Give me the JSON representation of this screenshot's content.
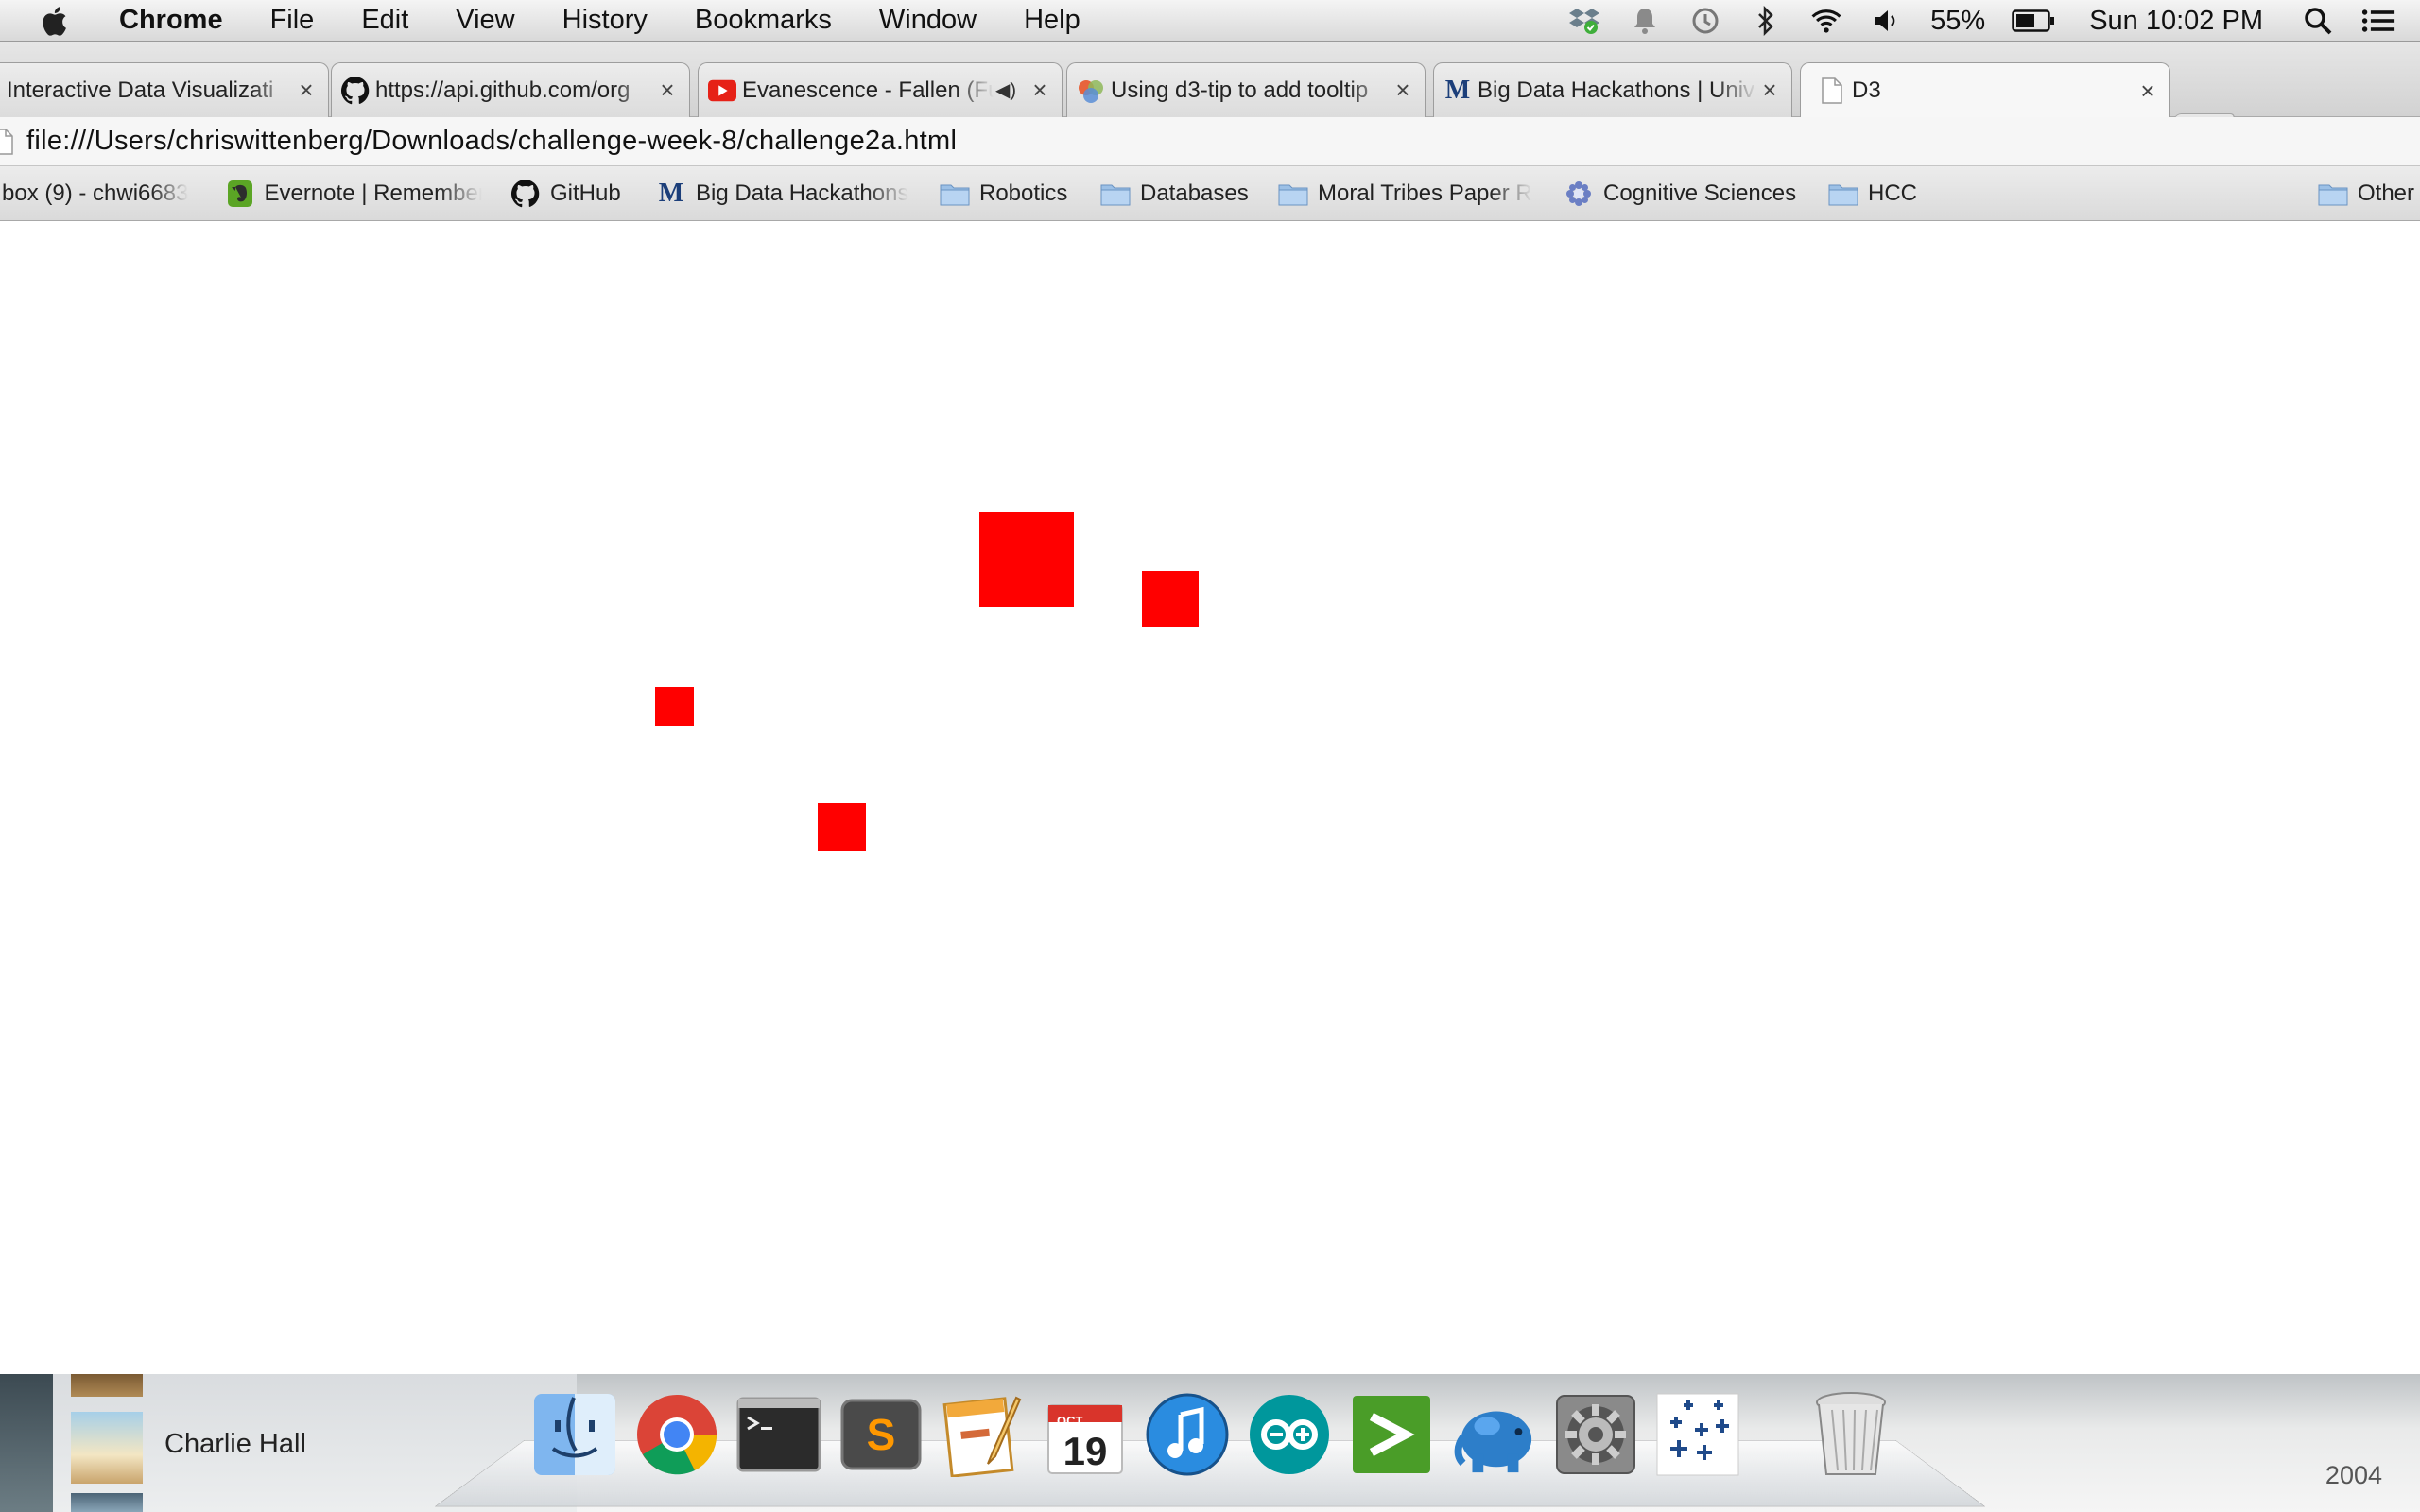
{
  "menubar": {
    "app_name": "Chrome",
    "menus": [
      "File",
      "Edit",
      "View",
      "History",
      "Bookmarks",
      "Window",
      "Help"
    ],
    "battery": "55%",
    "clock": "Sun 10:02 PM",
    "status_icons": [
      "dropbox-icon",
      "notification-icon",
      "time-machine-icon",
      "bluetooth-icon",
      "wifi-icon",
      "volume-icon",
      "battery-icon",
      "spotlight-icon",
      "notification-center-icon"
    ]
  },
  "tabs": [
    {
      "title": "Interactive Data Visualizati",
      "favicon": "none",
      "close": "×"
    },
    {
      "title": "https://api.github.com/org",
      "favicon": "github-icon",
      "close": "×"
    },
    {
      "title": "Evanescence - Fallen (Fu",
      "favicon": "youtube-icon",
      "close": "×",
      "audio": "◀)"
    },
    {
      "title": "Using d3-tip to add tooltip",
      "favicon": "d3-icon",
      "close": "×"
    },
    {
      "title": "Big Data Hackathons | Univ",
      "favicon": "m-icon",
      "close": "×"
    },
    {
      "title": "D3",
      "favicon": "page-icon",
      "close": "×"
    }
  ],
  "address": {
    "url": "file:///Users/chriswittenberg/Downloads/challenge-week-8/challenge2a.html"
  },
  "bookmarks": [
    {
      "label": "box (9) - chwi6683",
      "icon": "none"
    },
    {
      "label": "Evernote | Remember",
      "icon": "evernote-icon"
    },
    {
      "label": "GitHub",
      "icon": "github-icon"
    },
    {
      "label": "Big Data Hackathons",
      "icon": "m-icon"
    },
    {
      "label": "Robotics",
      "icon": "folder-icon"
    },
    {
      "label": "Databases",
      "icon": "folder-icon"
    },
    {
      "label": "Moral Tribes Paper R",
      "icon": "folder-icon"
    },
    {
      "label": "Cognitive Sciences",
      "icon": "gear-flower-icon"
    },
    {
      "label": "HCC",
      "icon": "folder-icon"
    },
    {
      "label": "Other",
      "icon": "folder-icon"
    }
  ],
  "content": {
    "squares_color": "#ff0000"
  },
  "dock": {
    "now_playing": "Charlie Hall",
    "year": "2004",
    "calendar_month": "OCT",
    "calendar_day": "19",
    "apps": [
      "finder-icon",
      "chrome-icon",
      "terminal-icon",
      "sublime-text-icon",
      "pages-icon",
      "calendar-icon",
      "itunes-icon",
      "arduino-icon",
      "prompt-icon",
      "sequel-pro-icon",
      "system-preferences-icon",
      "plus-grid-icon",
      "trash-icon"
    ]
  }
}
